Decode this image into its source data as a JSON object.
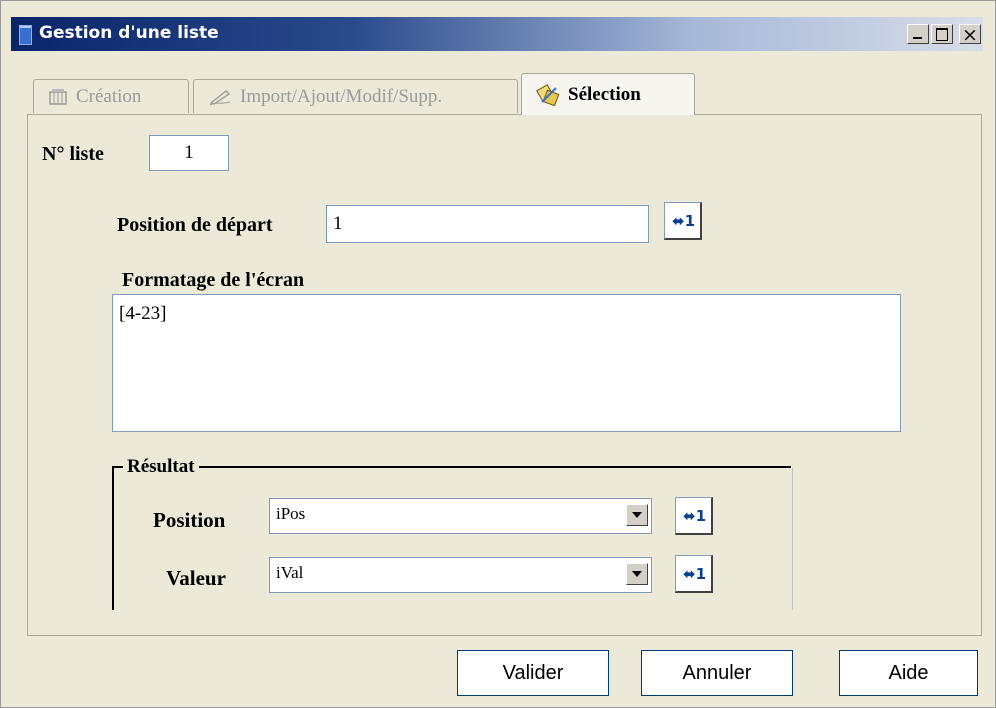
{
  "window": {
    "title": "Gestion d'une liste",
    "controls": {
      "minimize": "minimize-icon",
      "maximize": "maximize-icon",
      "close": "×"
    }
  },
  "tabs": [
    {
      "label": "Création",
      "icon": "creation-icon",
      "active": false
    },
    {
      "label": "Import/Ajout/Modif/Supp.",
      "icon": "edit-pen-icon",
      "active": false
    },
    {
      "label": "Sélection",
      "icon": "selection-icon",
      "active": true
    }
  ],
  "form": {
    "list_number_label": "N° liste",
    "list_number_value": "1",
    "start_position_label": "Position de départ",
    "start_position_value": "1",
    "screen_format_label": "Formatage de l'écran",
    "screen_format_value": "[4-23]"
  },
  "result": {
    "legend": "Résultat",
    "position_label": "Position",
    "position_value": "iPos",
    "value_label": "Valeur",
    "value_value": "iVal"
  },
  "picker_icon": "variable-picker-icon",
  "picker_glyph": "⬌1",
  "buttons": {
    "validate": "Valider",
    "cancel": "Annuler",
    "help": "Aide"
  },
  "colors": {
    "title_gradient_start": "#0a246a",
    "window_bg": "#ece9d8",
    "picker_arrow": "#0a3f8c"
  }
}
